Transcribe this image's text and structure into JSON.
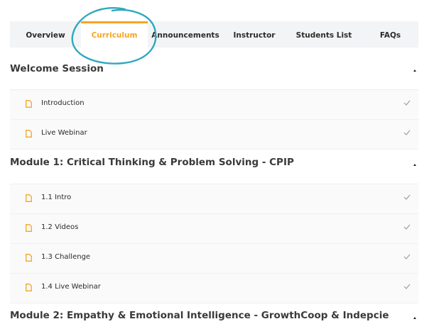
{
  "tabs": [
    {
      "label": "Overview",
      "active": false
    },
    {
      "label": "Curriculum",
      "active": true
    },
    {
      "label": "Announcements",
      "active": false
    },
    {
      "label": "Instructor",
      "active": false
    },
    {
      "label": "Students List",
      "active": false
    },
    {
      "label": "FAQs",
      "active": false
    }
  ],
  "colors": {
    "accent": "#f5a623",
    "highlight_circle": "#2ea8c0"
  },
  "sections": [
    {
      "title": "Welcome Session",
      "lessons": [
        {
          "title": "Introduction"
        },
        {
          "title": "Live Webinar"
        }
      ]
    },
    {
      "title": "Module 1: Critical Thinking & Problem Solving - CPIP",
      "lessons": [
        {
          "title": "1.1 Intro"
        },
        {
          "title": "1.2 Videos"
        },
        {
          "title": "1.3 Challenge"
        },
        {
          "title": "1.4 Live Webinar"
        }
      ]
    },
    {
      "title": "Module 2: Empathy & Emotional Intelligence - GrowthCoop & Indepcie",
      "lessons": []
    }
  ]
}
